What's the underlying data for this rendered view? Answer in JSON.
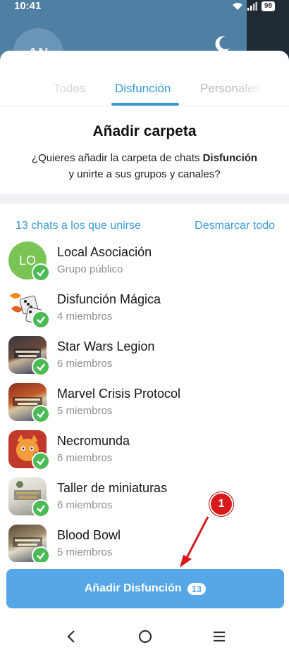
{
  "status_bar": {
    "time": "10:41",
    "battery": "98"
  },
  "background": {
    "avatar_initials": "AN"
  },
  "tabs": [
    {
      "label": "Todos"
    },
    {
      "label": "Disfunción"
    },
    {
      "label": "Personales"
    }
  ],
  "dialog": {
    "title": "Añadir carpeta",
    "desc_prefix": "¿Quieres añadir la carpeta de chats ",
    "desc_folder": "Disfunción",
    "desc_suffix": "y unirte a sus grupos y canales?"
  },
  "list": {
    "count_label": "13 chats a los que unirse",
    "unmark_label": "Desmarcar todo"
  },
  "chats": [
    {
      "name": "Local Asociación",
      "sub": "Grupo público",
      "initials": "LO",
      "avatar": "initials"
    },
    {
      "name": "Disfunción Mágica",
      "sub": "4 miembros",
      "avatar": "dice"
    },
    {
      "name": "Star Wars Legion",
      "sub": "6 miembros",
      "avatar": "poster"
    },
    {
      "name": "Marvel Crisis Protocol",
      "sub": "5 miembros",
      "avatar": "poster"
    },
    {
      "name": "Necromunda",
      "sub": "6 miembros",
      "avatar": "cat"
    },
    {
      "name": "Taller de miniaturas",
      "sub": "6 miembros",
      "avatar": "poster"
    },
    {
      "name": "Blood Bowl",
      "sub": "5 miembros",
      "avatar": "poster"
    }
  ],
  "button": {
    "label": "Añadir Disfunción",
    "count": "13"
  },
  "annotation": {
    "number": "1"
  },
  "colors": {
    "accent": "#3a9ad9",
    "button": "#56a7e7",
    "check": "#4cba55",
    "annotation": "#d81919"
  },
  "icons": [
    "wifi-icon",
    "signal-icon",
    "battery-icon",
    "moon-icon",
    "check-icon",
    "back-icon",
    "home-icon",
    "menu-icon"
  ]
}
